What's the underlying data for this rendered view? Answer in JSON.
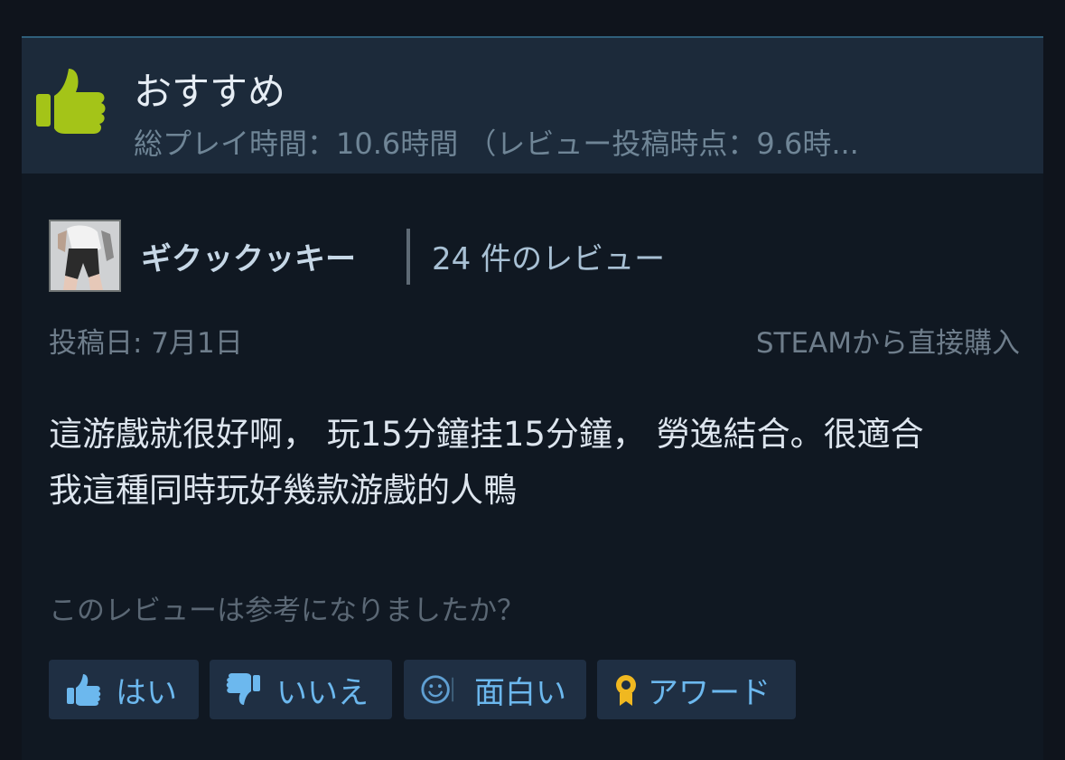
{
  "colors": {
    "thumb_up_green": "#a4c418",
    "button_blue": "#6cb8ee",
    "award_gold": "#f0b820"
  },
  "review": {
    "verdict": "おすすめ",
    "verdict_icon": "thumbs-up-icon",
    "playtime": "総プレイ時間：10.6時間 （レビュー投稿時点：9.6時...",
    "author": {
      "name": "ギクックッキー",
      "review_count": "24 件のレビュー"
    },
    "posted": "投稿日: 7月1日",
    "purchase_source": "STEAMから直接購入",
    "body_lines": [
      "這游戲就很好啊， 玩15分鐘挂15分鐘， 勞逸結合。很適合",
      "我這種同時玩好幾款游戲的人鴨"
    ]
  },
  "feedback": {
    "question": "このレビューは参考になりましたか？",
    "buttons": {
      "yes": {
        "label": "はい",
        "icon": "thumbs-up-icon"
      },
      "no": {
        "label": "いいえ",
        "icon": "thumbs-down-icon"
      },
      "funny": {
        "label": "面白い",
        "icon": "smiley-icon"
      },
      "award": {
        "label": "アワード",
        "icon": "award-ribbon-icon"
      }
    }
  }
}
